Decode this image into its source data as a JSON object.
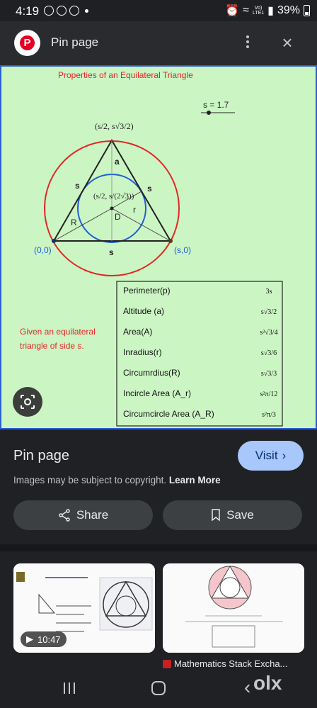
{
  "status_bar": {
    "time": "4:19",
    "network_top": "Vo)",
    "network_bottom": "LTE1",
    "battery": "39%"
  },
  "header": {
    "title": "Pin page",
    "menu_icon": "more-vert-icon",
    "close_icon": "close-icon"
  },
  "figure": {
    "title": "Properties of an Equilateral Triangle",
    "slider_label": "s = 1.7",
    "apex_label": "(s/2, s√3/2)",
    "center_label": "(s/2, s/(2√3))",
    "origin_label": "(0,0)",
    "right_label": "(s,0)",
    "side_label": "s",
    "altitude_label": "a",
    "inradius_label": "r",
    "circumradius_label": "R",
    "center_point_label": "D",
    "given_text_1": "Given an equilateral",
    "given_text_2": "triangle of side s.",
    "properties": [
      {
        "name": "Perimeter(p)",
        "formula": "3s"
      },
      {
        "name": "Altitude (a)",
        "formula": "s√3/2"
      },
      {
        "name": "Area(A)",
        "formula": "s²√3/4"
      },
      {
        "name": "Inradius(r)",
        "formula": "s√3/6"
      },
      {
        "name": "Circumrdius(R)",
        "formula": "s√3/3"
      },
      {
        "name": "Incircle Area (A_r)",
        "formula": "s²π/12"
      },
      {
        "name": "Circumcircle Area (A_R)",
        "formula": "s²π/3"
      }
    ],
    "colors": {
      "background": "#ccf5c4",
      "border": "#2b5fd0",
      "circumcircle": "#e32626",
      "incircle": "#1f5fd6",
      "title": "#e32626"
    }
  },
  "info": {
    "title": "Pin page",
    "visit_label": "Visit",
    "copyright_text": "Images may be subject to copyright.",
    "learn_more": "Learn More",
    "share_label": "Share",
    "save_label": "Save"
  },
  "related": {
    "video_duration": "10:47",
    "source_label": "Mathematics Stack Excha..."
  },
  "watermark": "olx"
}
